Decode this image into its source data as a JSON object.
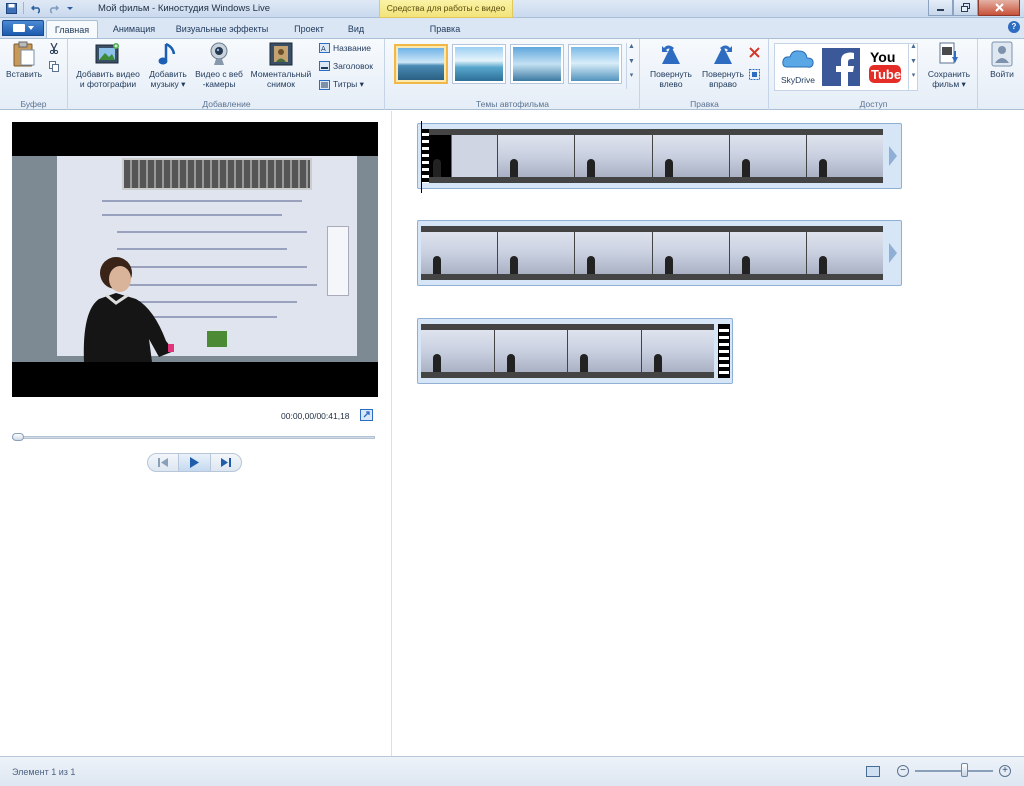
{
  "window": {
    "title": "Мой фильм - Киностудия Windows Live",
    "context_tab_header": "Средства для работы с видео",
    "controls": [
      "minimize",
      "maximize",
      "close"
    ]
  },
  "quick_access": [
    "save-icon",
    "undo-icon",
    "redo-icon",
    "customize-icon"
  ],
  "tabs": [
    {
      "label": "Главная",
      "active": true
    },
    {
      "label": "Анимация",
      "active": false
    },
    {
      "label": "Визуальные эффекты",
      "active": false
    },
    {
      "label": "Проект",
      "active": false
    },
    {
      "label": "Вид",
      "active": false
    },
    {
      "label": "Правка",
      "active": false
    }
  ],
  "ribbon": {
    "buffer": {
      "label": "Буфер",
      "paste": "Вставить"
    },
    "add": {
      "label": "Добавление",
      "add_video_line1": "Добавить видео",
      "add_video_line2": "и фотографии",
      "add_music_line1": "Добавить",
      "add_music_line2": "музыку",
      "webcam_line1": "Видео с веб",
      "webcam_line2": "-камеры",
      "snapshot_line1": "Моментальный",
      "snapshot_line2": "снимок",
      "title": "Название",
      "caption": "Заголовок",
      "credits": "Титры"
    },
    "themes": {
      "label": "Темы автофильма",
      "items": 4,
      "selected_index": 0
    },
    "edit": {
      "label": "Правка",
      "rotate_left_line1": "Повернуть",
      "rotate_left_line2": "влево",
      "rotate_right_line1": "Повернуть",
      "rotate_right_line2": "вправо"
    },
    "share": {
      "label": "Доступ",
      "skydrive": "SkyDrive",
      "save_movie_line1": "Сохранить",
      "save_movie_line2": "фильм"
    },
    "signin": "Войти"
  },
  "preview": {
    "timecode": "00:00,00/00:41,18",
    "seek_position": 0
  },
  "storyboard": {
    "clips": [
      {
        "frames": 6
      },
      {
        "frames": 6
      },
      {
        "frames": 4
      }
    ]
  },
  "status": {
    "text": "Элемент 1 из 1",
    "zoom_level": 0.6
  },
  "colors": {
    "accent": "#2d6cc0",
    "context_tab": "#f2e37a",
    "selection": "#f0b848"
  }
}
